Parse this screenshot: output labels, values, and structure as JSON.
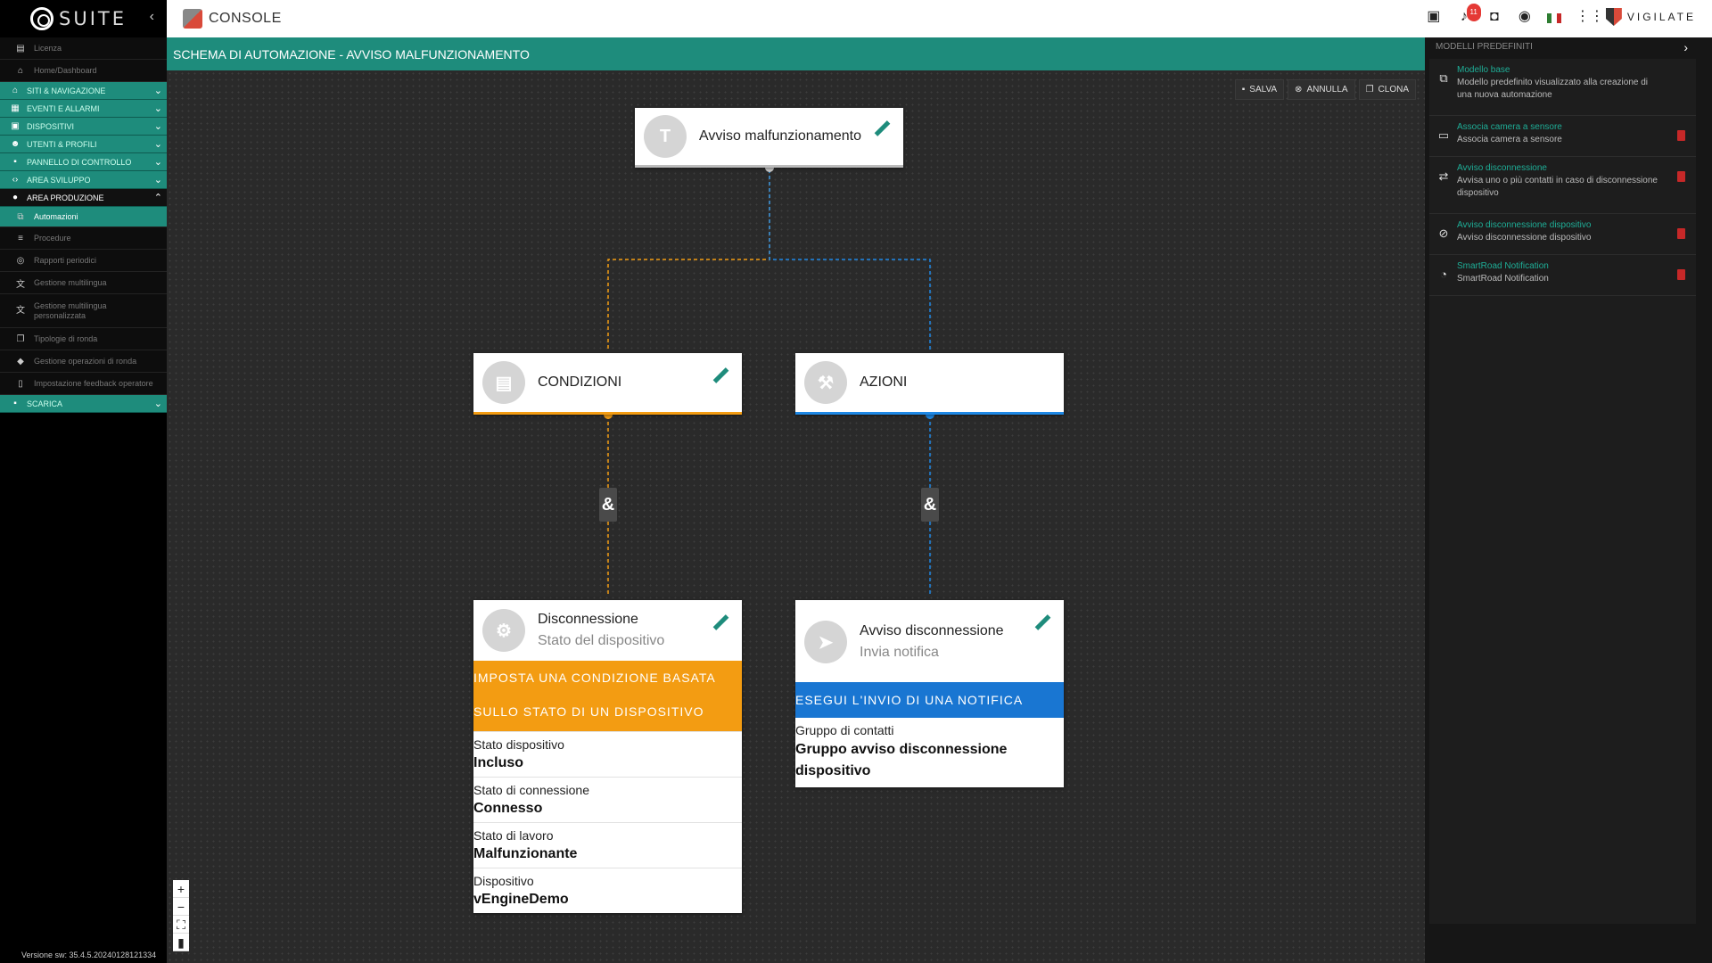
{
  "brand": {
    "suite": "SUITE",
    "console": "CONSOLE",
    "vigilate": "VIGILATE"
  },
  "notifications_count": "11",
  "sidebar": {
    "items": [
      {
        "label": "Licenza",
        "type": "plain",
        "icon": "id-card-icon"
      },
      {
        "label": "Home/Dashboard",
        "type": "plain",
        "icon": "home-icon"
      },
      {
        "label": "SITI & NAVIGAZIONE",
        "type": "section",
        "icon": "home-icon"
      },
      {
        "label": "EVENTI E ALLARMI",
        "type": "section",
        "icon": "clipboard-icon"
      },
      {
        "label": "DISPOSITIVI",
        "type": "section",
        "icon": "device-icon"
      },
      {
        "label": "UTENTI & PROFILI",
        "type": "section",
        "icon": "users-icon"
      },
      {
        "label": "PANNELLO DI CONTROLLO",
        "type": "section",
        "icon": "briefcase-icon"
      },
      {
        "label": "AREA SVILUPPO",
        "type": "section",
        "icon": "code-icon"
      },
      {
        "label": "AREA PRODUZIONE",
        "type": "section-open",
        "icon": "user-icon"
      },
      {
        "label": "Automazioni",
        "type": "active",
        "icon": "sitemap-icon"
      },
      {
        "label": "Procedure",
        "type": "plain",
        "icon": "procedure-icon"
      },
      {
        "label": "Rapporti periodici",
        "type": "plain",
        "icon": "report-icon"
      },
      {
        "label": "Gestione multilingua",
        "type": "plain",
        "icon": "language-icon"
      },
      {
        "label": "Gestione multilingua personalizzata",
        "type": "plain-two",
        "icon": "language-icon"
      },
      {
        "label": "Tipologie di ronda",
        "type": "plain",
        "icon": "copy-icon"
      },
      {
        "label": "Gestione operazioni di ronda",
        "type": "plain",
        "icon": "diamond-icon"
      },
      {
        "label": "Impostazione feedback operatore",
        "type": "plain",
        "icon": "phone-icon"
      },
      {
        "label": "SCARICA",
        "type": "section",
        "icon": "briefcase-icon"
      }
    ],
    "version": "Versione sw: 35.4.5.20240128121334"
  },
  "title": "SCHEMA DI AUTOMAZIONE - AVVISO MALFUNZIONAMENTO",
  "toolbar": {
    "save": "SALVA",
    "cancel": "ANNULLA",
    "clone": "CLONA"
  },
  "nodes": {
    "root": {
      "avatar": "T",
      "title": "Avviso malfunzionamento"
    },
    "conditions": {
      "title": "CONDIZIONI"
    },
    "actions": {
      "title": "AZIONI"
    },
    "amp": "&",
    "condition": {
      "title": "Disconnessione",
      "subtitle": "Stato del dispositivo",
      "band": "IMPOSTA UNA CONDIZIONE BASATA SULLO STATO DI UN DISPOSITIVO",
      "fields": [
        {
          "label": "Stato dispositivo",
          "value": "Incluso"
        },
        {
          "label": "Stato di connessione",
          "value": "Connesso"
        },
        {
          "label": "Stato di lavoro",
          "value": "Malfunzionante"
        },
        {
          "label": "Dispositivo",
          "value": "vEngineDemo"
        }
      ]
    },
    "action": {
      "title": "Avviso disconnessione",
      "subtitle": "Invia notifica",
      "band": "ESEGUI L'INVIO DI UNA NOTIFICA",
      "fields": [
        {
          "label": "Gruppo di contatti",
          "value": "Gruppo avviso disconnessione dispositivo"
        }
      ]
    }
  },
  "zoom": {
    "plus": "+",
    "minus": "−"
  },
  "templates_panel": {
    "header": "MODELLI PREDEFINITI",
    "items": [
      {
        "title": "Modello base",
        "desc": "Modello predefinito visualizzato alla creazione di una nuova automazione",
        "deletable": false
      },
      {
        "title": "Associa camera a sensore",
        "desc": "Associa camera a sensore",
        "deletable": true
      },
      {
        "title": "Avviso disconnessione",
        "desc": "Avvisa uno o più contatti in caso di disconnessione dispositivo",
        "deletable": true
      },
      {
        "title": "Avviso disconnessione dispositivo",
        "desc": "Avviso disconnessione dispositivo",
        "deletable": true
      },
      {
        "title": "SmartRoad Notification",
        "desc": "SmartRoad Notification",
        "deletable": true
      }
    ]
  },
  "colors": {
    "accent": "#1e8c7c",
    "conditions": "#f39c12",
    "actions": "#1976d2"
  }
}
